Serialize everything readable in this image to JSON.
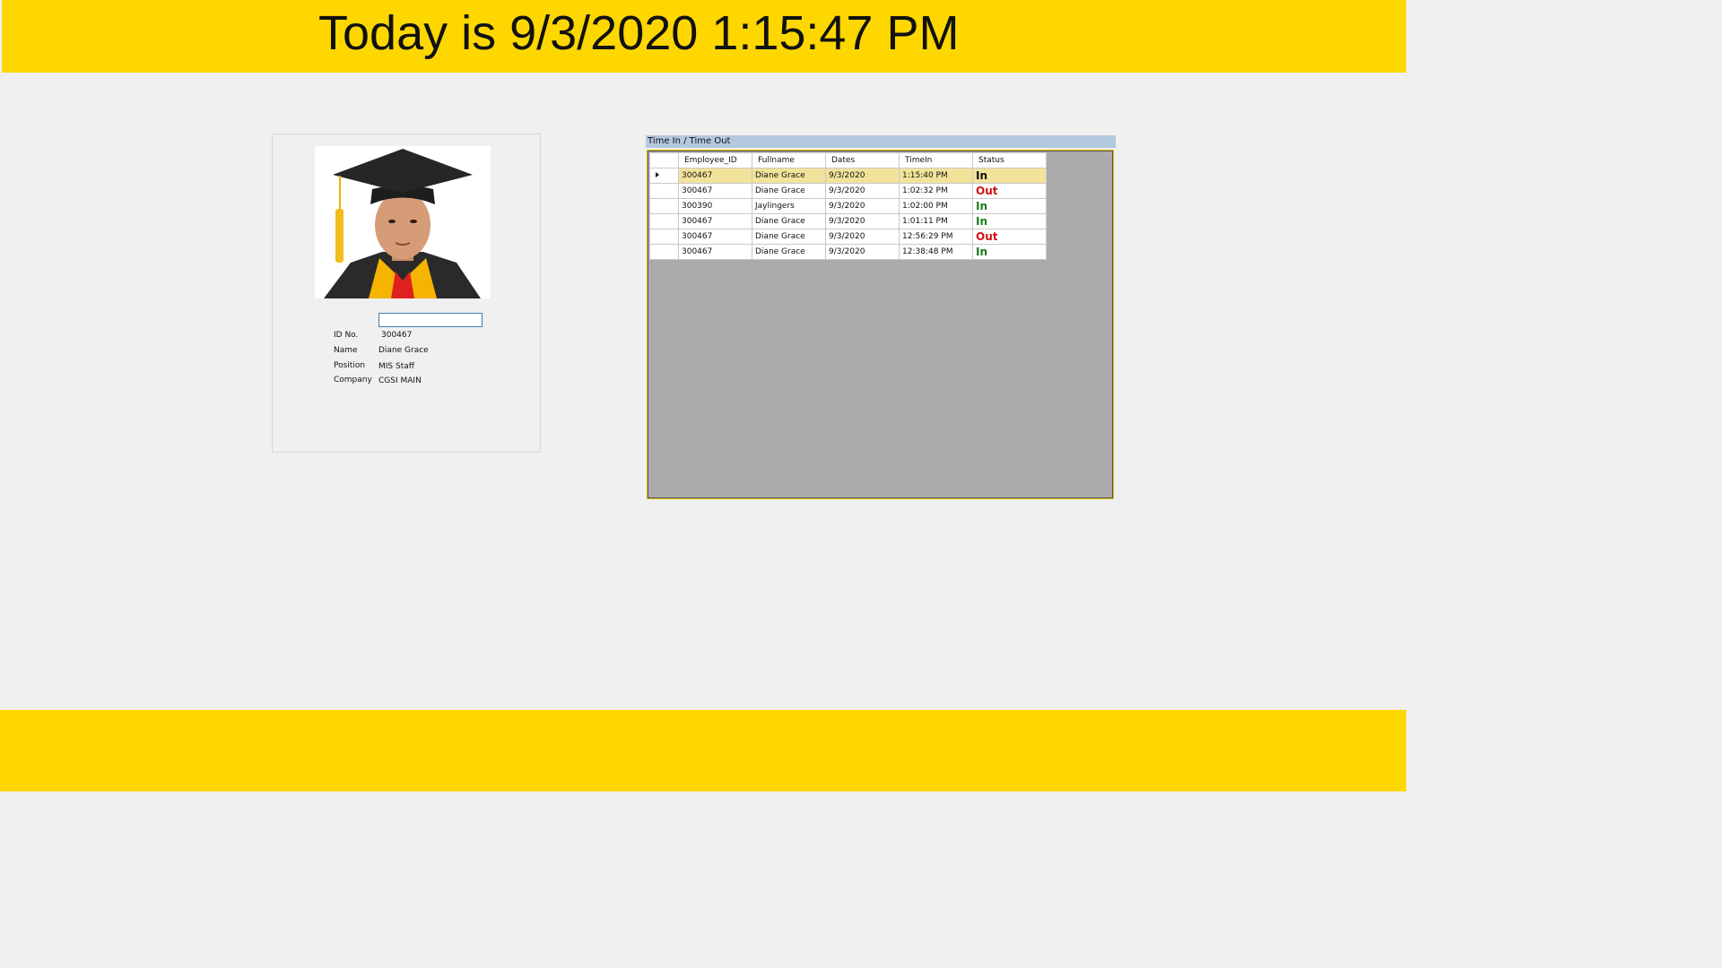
{
  "header": {
    "clock_text": "Today is 9/3/2020 1:15:47 PM"
  },
  "profile": {
    "scan_input_value": "",
    "fields": [
      {
        "label": "ID No.",
        "value": "300467"
      },
      {
        "label": "Name",
        "value": "Diane Grace"
      },
      {
        "label": "Position",
        "value": "MIS Staff"
      },
      {
        "label": "Company",
        "value": "CGSI MAIN"
      }
    ]
  },
  "log": {
    "caption": "Time In / Time Out",
    "columns": [
      "Employee_ID",
      "Fullname",
      "Dates",
      "TimeIn",
      "Status"
    ],
    "rows": [
      {
        "employee_id": "300467",
        "fullname": "Diane Grace",
        "date": "9/3/2020",
        "time_in": "1:15:40 PM",
        "status": "In"
      },
      {
        "employee_id": "300467",
        "fullname": "Diane Grace",
        "date": "9/3/2020",
        "time_in": "1:02:32 PM",
        "status": "Out"
      },
      {
        "employee_id": "300390",
        "fullname": "Jaylingers",
        "date": "9/3/2020",
        "time_in": "1:02:00 PM",
        "status": "In"
      },
      {
        "employee_id": "300467",
        "fullname": "Diane Grace",
        "date": "9/3/2020",
        "time_in": "1:01:11 PM",
        "status": "In"
      },
      {
        "employee_id": "300467",
        "fullname": "Diane Grace",
        "date": "9/3/2020",
        "time_in": "12:56:29 PM",
        "status": "Out"
      },
      {
        "employee_id": "300467",
        "fullname": "Diane Grace",
        "date": "9/3/2020",
        "time_in": "12:38:48 PM",
        "status": "In"
      }
    ]
  },
  "colors": {
    "banner": "#ffd700",
    "status_in": "#1e7a1e",
    "status_out": "#d01010",
    "selected_row": "#f2e39a"
  }
}
